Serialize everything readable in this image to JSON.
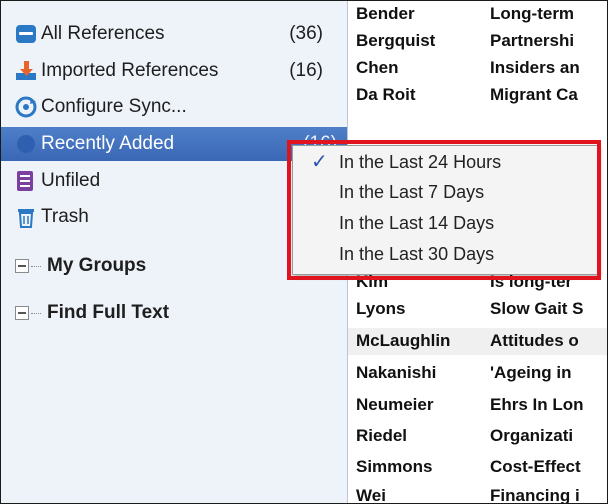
{
  "sidebar": {
    "items": [
      {
        "label": "All References",
        "count": "(36)",
        "icon": "library-icon"
      },
      {
        "label": "Imported References",
        "count": "(16)",
        "icon": "import-icon"
      },
      {
        "label": "Configure Sync...",
        "count": "",
        "icon": "sync-icon"
      },
      {
        "label": "Recently Added",
        "count": "(16)",
        "icon": "clock-icon"
      },
      {
        "label": "Unfiled",
        "count": "",
        "icon": "unfiled-icon"
      },
      {
        "label": "Trash",
        "count": "",
        "icon": "trash-icon"
      }
    ],
    "groups": [
      {
        "label": "My Groups"
      },
      {
        "label": "Find Full Text"
      }
    ]
  },
  "references": {
    "top_rows": [
      {
        "author": "Bender",
        "title": "Long-term"
      },
      {
        "author": "Bergquist",
        "title": "Partnershi"
      },
      {
        "author": "Chen",
        "title": "Insiders an"
      },
      {
        "author": "Da Roit",
        "title": "Migrant Ca"
      }
    ],
    "bottom_rows": [
      {
        "author": "Kim",
        "title": "Is long-ter"
      },
      {
        "author": "Lyons",
        "title": "Slow Gait S"
      },
      {
        "author": "McLaughlin",
        "title": "Attitudes o"
      },
      {
        "author": "Nakanishi",
        "title": "'Ageing in"
      },
      {
        "author": "Neumeier",
        "title": "Ehrs In Lon"
      },
      {
        "author": "Riedel",
        "title": "Organizati"
      },
      {
        "author": "Simmons",
        "title": "Cost-Effect"
      },
      {
        "author": "Wei",
        "title": "Financing i"
      }
    ]
  },
  "recent_menu": {
    "options": [
      {
        "label": "In the Last 24 Hours",
        "checked": true
      },
      {
        "label": "In the Last 7 Days",
        "checked": false
      },
      {
        "label": "In the Last 14 Days",
        "checked": false
      },
      {
        "label": "In the Last 30 Days",
        "checked": false
      }
    ],
    "check_mark": "✓"
  },
  "colors": {
    "selection": "#3a67b5",
    "highlight_border": "#e0141e",
    "sidebar_bg": "#eef3fa"
  }
}
